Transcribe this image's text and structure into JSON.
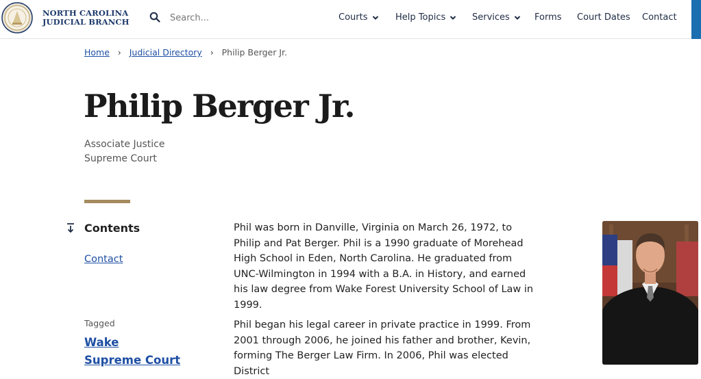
{
  "header": {
    "brand_line1": "NORTH CAROLINA",
    "brand_line2": "JUDICIAL BRANCH",
    "search_placeholder": "Search...",
    "nav": [
      {
        "label": "Courts",
        "has_dropdown": true
      },
      {
        "label": "Help Topics",
        "has_dropdown": true
      },
      {
        "label": "Services",
        "has_dropdown": true
      },
      {
        "label": "Forms",
        "has_dropdown": false
      },
      {
        "label": "Court Dates",
        "has_dropdown": false
      },
      {
        "label": "Contact",
        "has_dropdown": false
      }
    ],
    "accent_color": "#1a6fb0"
  },
  "breadcrumb": [
    {
      "label": "Home"
    },
    {
      "label": "Judicial Directory"
    },
    {
      "label": "Philip Berger Jr."
    }
  ],
  "page": {
    "title": "Philip Berger Jr.",
    "position": "Associate Justice",
    "court": "Supreme Court",
    "rule_color": "#a48a5e"
  },
  "sidebar": {
    "contents_title": "Contents",
    "links": [
      {
        "label": "Contact"
      }
    ],
    "tagged_label": "Tagged",
    "tags": [
      {
        "label": "Wake"
      },
      {
        "label": "Supreme Court"
      }
    ]
  },
  "bio": {
    "paragraphs": [
      "Phil was born in Danville, Virginia on March 26, 1972, to Philip and Pat Berger. Phil is a 1990 graduate of Morehead High School in Eden, North Carolina. He graduated from UNC-Wilmington in 1994 with a B.A. in History, and earned his law degree from Wake Forest University School of Law in 1999.",
      "Phil began his legal career in private practice in 1999. From 2001 through 2006, he joined his father and brother, Kevin, forming The Berger Law Firm. In 2006, Phil was elected District"
    ]
  },
  "icons": {
    "seal": "nc-judicial-seal-icon",
    "search": "search-icon",
    "dropdown": "chevron-down-icon",
    "contents": "arrow-down-to-line-icon"
  }
}
